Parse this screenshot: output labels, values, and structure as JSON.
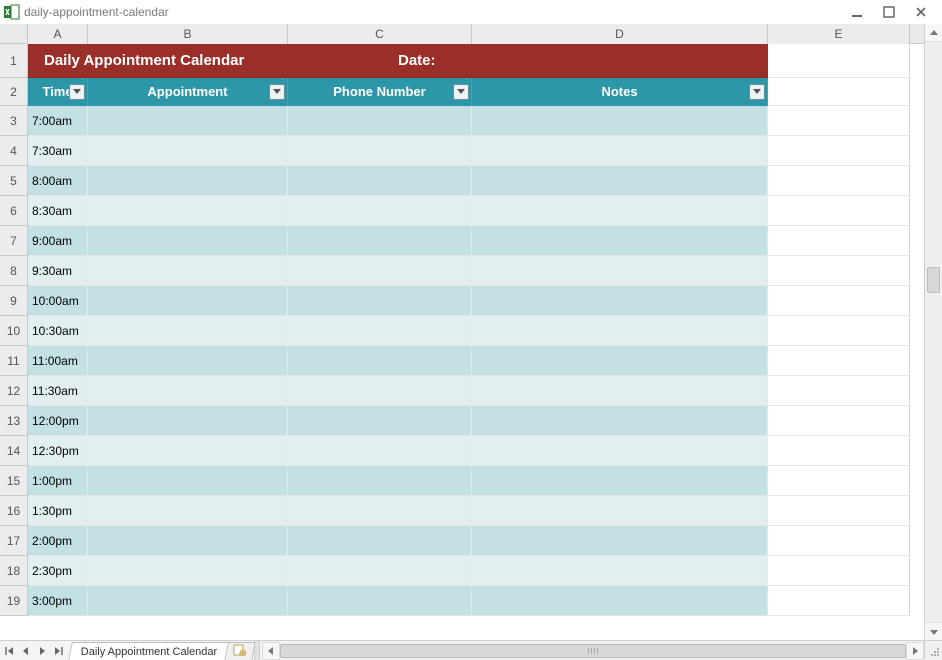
{
  "window": {
    "title": "daily-appointment-calendar"
  },
  "columns": {
    "A": "A",
    "B": "B",
    "C": "C",
    "D": "D",
    "E": "E"
  },
  "banner": {
    "title": "Daily Appointment Calendar",
    "date_label": "Date:"
  },
  "headers": {
    "time": "Time",
    "appointment": "Appointment",
    "phone": "Phone Number",
    "notes": "Notes"
  },
  "rows": [
    {
      "num": "1"
    },
    {
      "num": "2"
    },
    {
      "num": "3",
      "time": "7:00am"
    },
    {
      "num": "4",
      "time": "7:30am"
    },
    {
      "num": "5",
      "time": "8:00am"
    },
    {
      "num": "6",
      "time": "8:30am"
    },
    {
      "num": "7",
      "time": "9:00am"
    },
    {
      "num": "8",
      "time": "9:30am"
    },
    {
      "num": "9",
      "time": "10:00am"
    },
    {
      "num": "10",
      "time": "10:30am"
    },
    {
      "num": "11",
      "time": "11:00am"
    },
    {
      "num": "12",
      "time": "11:30am"
    },
    {
      "num": "13",
      "time": "12:00pm"
    },
    {
      "num": "14",
      "time": "12:30pm"
    },
    {
      "num": "15",
      "time": "1:00pm"
    },
    {
      "num": "16",
      "time": "1:30pm"
    },
    {
      "num": "17",
      "time": "2:00pm"
    },
    {
      "num": "18",
      "time": "2:30pm"
    },
    {
      "num": "19",
      "time": "3:00pm"
    }
  ],
  "sheet_tab": {
    "name": "Daily Appointment Calendar"
  }
}
